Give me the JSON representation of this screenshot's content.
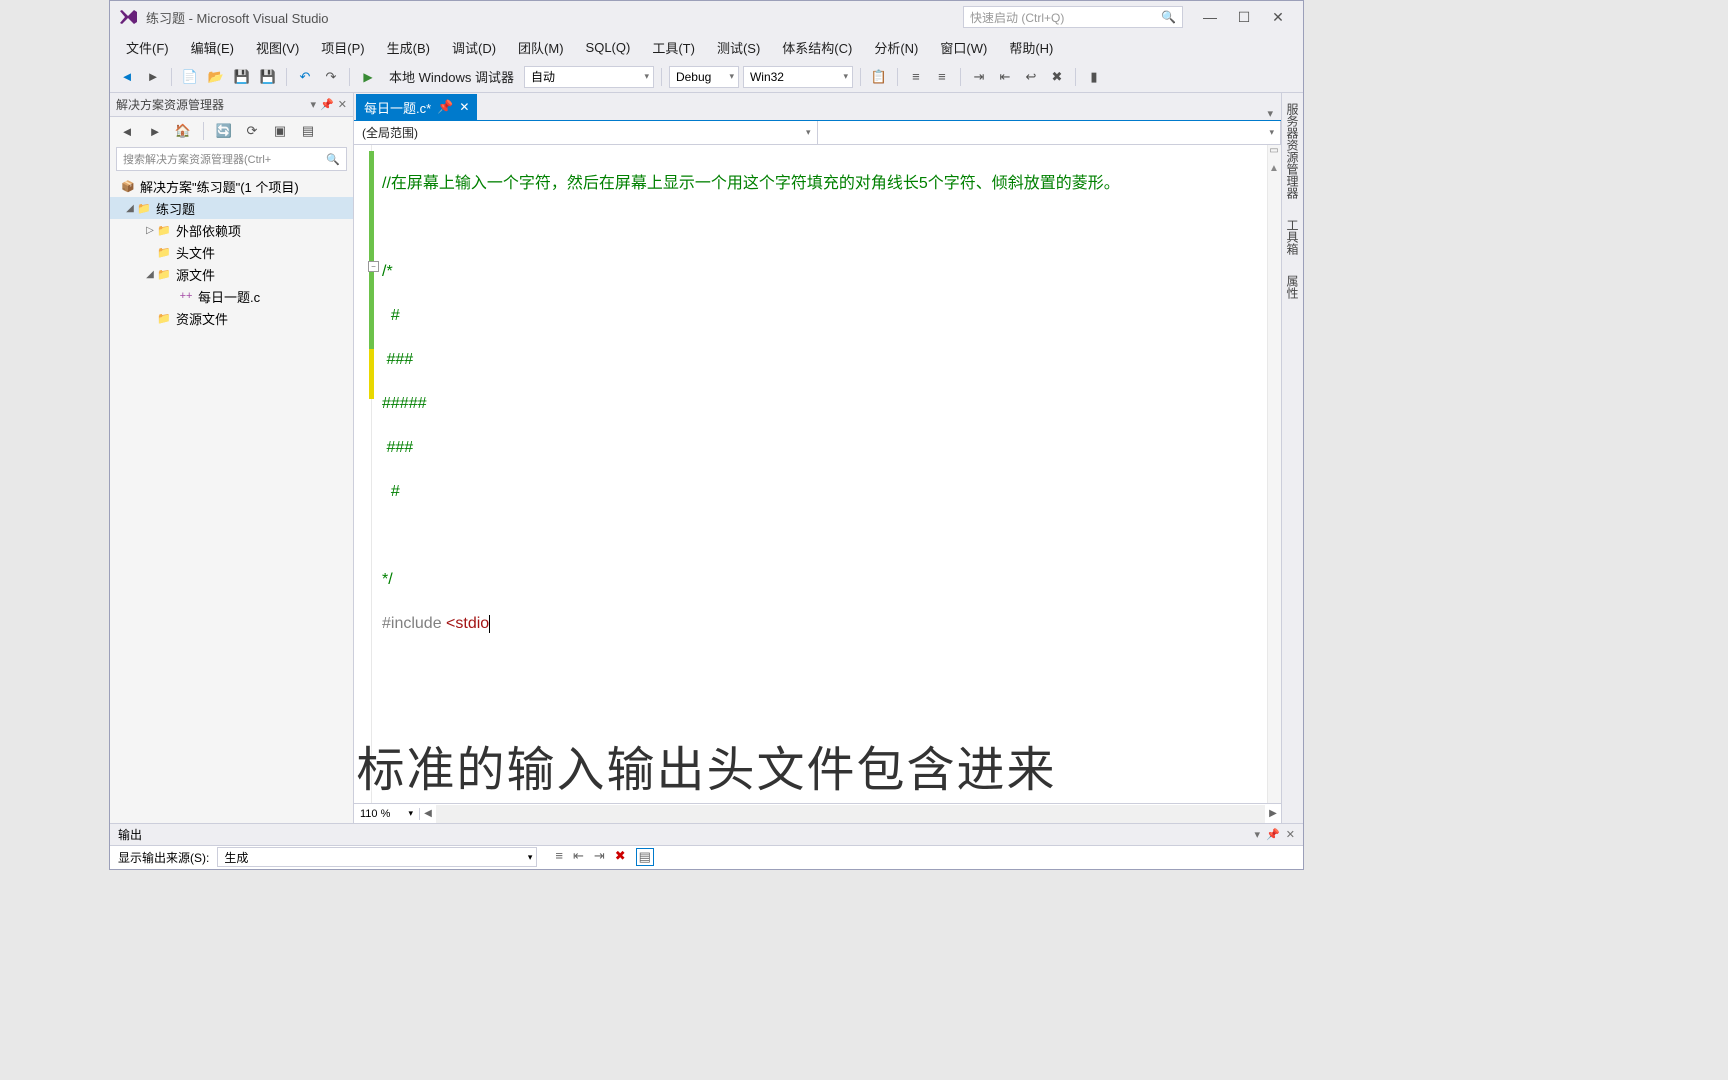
{
  "titlebar": {
    "title": "练习题 - Microsoft Visual Studio",
    "quicklaunch_placeholder": "快速启动 (Ctrl+Q)"
  },
  "menubar": {
    "items": [
      "文件(F)",
      "编辑(E)",
      "视图(V)",
      "项目(P)",
      "生成(B)",
      "调试(D)",
      "团队(M)",
      "SQL(Q)",
      "工具(T)",
      "测试(S)",
      "体系结构(C)",
      "分析(N)",
      "窗口(W)",
      "帮助(H)"
    ]
  },
  "toolbar": {
    "debug_target": "本地 Windows 调试器",
    "solution_config": "自动",
    "solution_config2": "Debug",
    "platform": "Win32"
  },
  "solution_explorer": {
    "title": "解决方案资源管理器",
    "search_placeholder": "搜索解决方案资源管理器(Ctrl+",
    "root": "解决方案\"练习题\"(1 个项目)",
    "project": "练习题",
    "folders": {
      "external": "外部依赖项",
      "headers": "头文件",
      "sources": "源文件",
      "resources": "资源文件"
    },
    "source_file": "每日一题.c"
  },
  "editor": {
    "tab_name": "每日一题.c*",
    "scope": "(全局范围)",
    "zoom": "110 %",
    "code": {
      "line1_comment": "//在屏幕上输入一个字符，然后在屏幕上显示一个用这个字符填充的对角线长5个字符、倾斜放置的菱形。",
      "block_open": "/*",
      "block_l1": "  #",
      "block_l2": " ###",
      "block_l3": "#####",
      "block_l4": " ###",
      "block_l5": "  #",
      "block_close": "*/",
      "include_keyword": "#include ",
      "include_arg": "<stdio"
    }
  },
  "right_panels": [
    "服务器资源管理器",
    "工具箱",
    "属性"
  ],
  "output": {
    "title": "输出",
    "source_label": "显示输出来源(S):",
    "source_value": "生成"
  },
  "subtitle": "标准的输入输出头文件包含进来"
}
